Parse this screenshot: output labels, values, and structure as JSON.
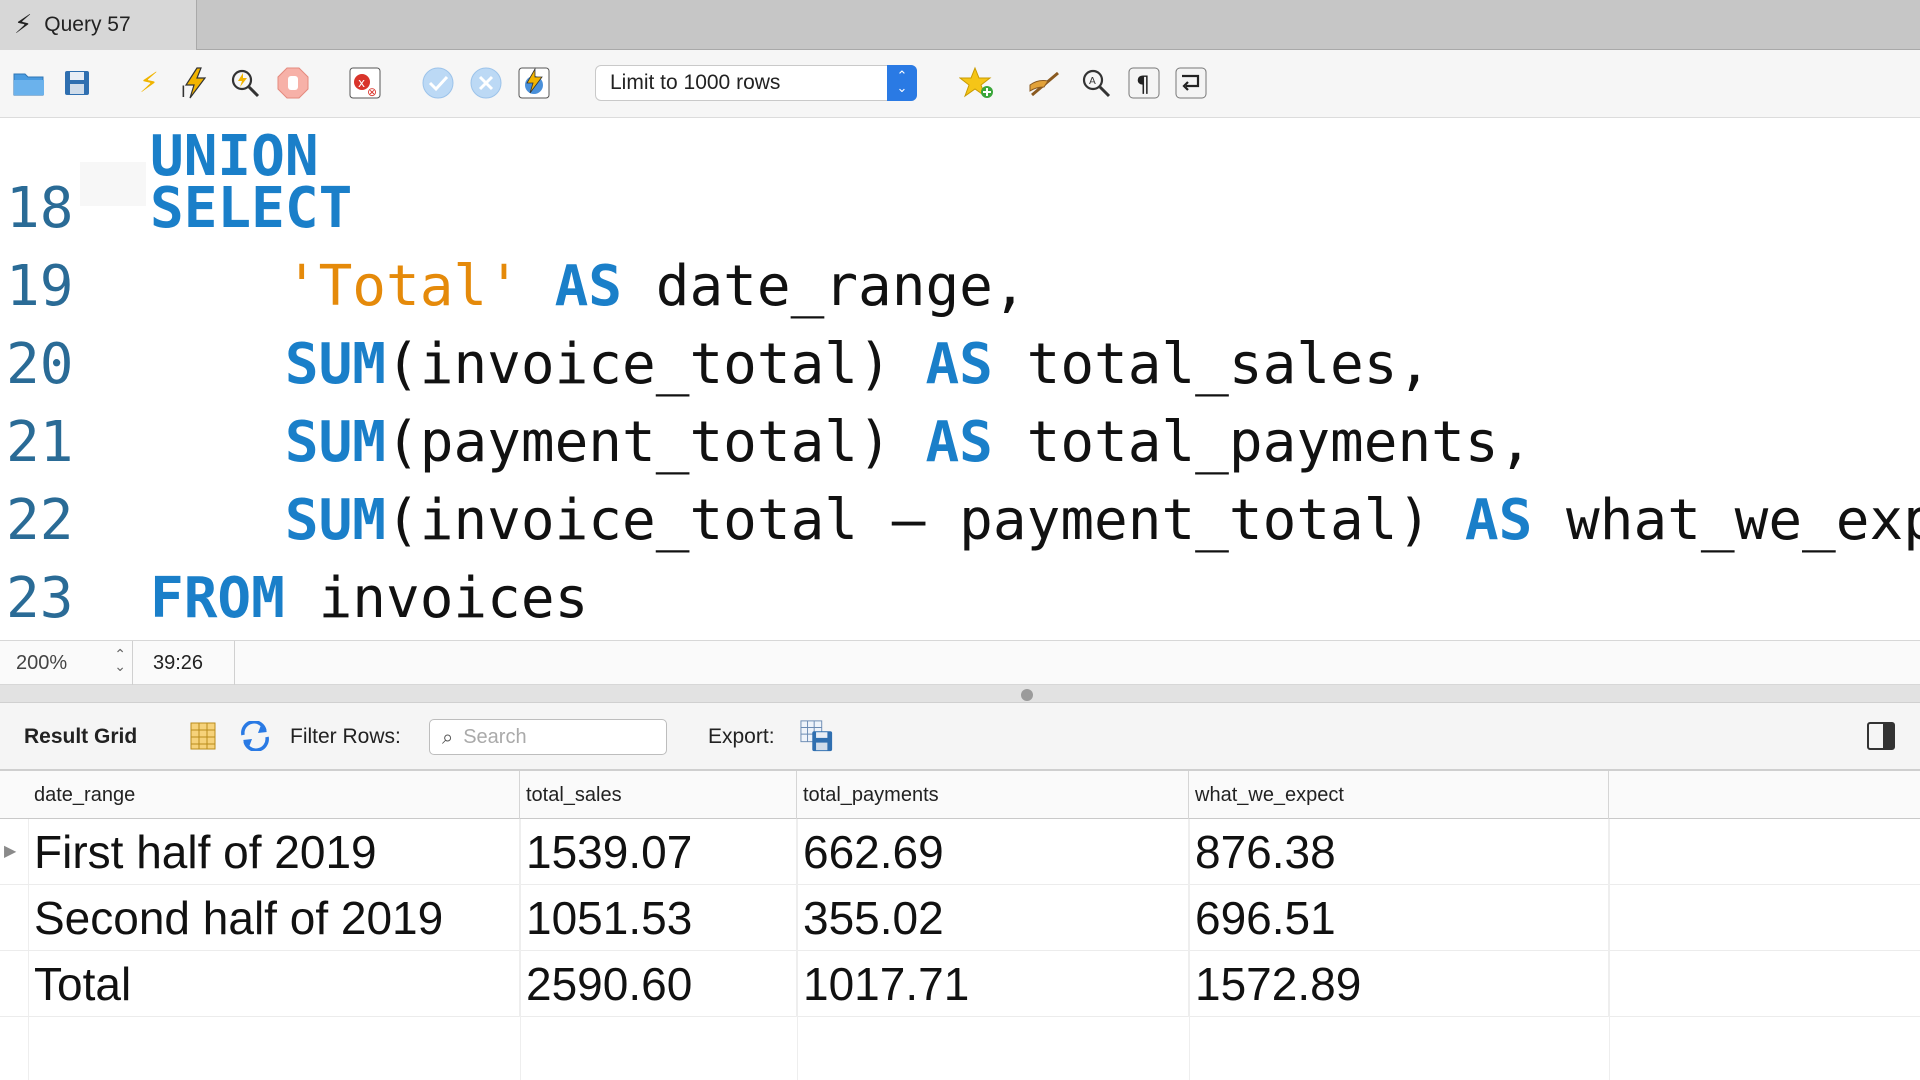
{
  "tab": {
    "title": "Query 57",
    "icon": "bolt-icon"
  },
  "toolbar": {
    "icons": [
      "open-folder-icon",
      "save-icon",
      "execute-icon",
      "execute-current-icon",
      "explain-icon",
      "stop-icon",
      "toggle-error-icon",
      "commit-icon",
      "rollback-icon",
      "autocommit-icon",
      "add-snippet-icon",
      "beautify-icon",
      "find-icon",
      "invisibles-icon",
      "wrap-icon"
    ],
    "limit_label": "Limit to 1000 rows"
  },
  "editor": {
    "lines": [
      {
        "num": "",
        "tokens": [
          {
            "t": "UNION",
            "c": "kw"
          }
        ]
      },
      {
        "num": "18",
        "tokens": [
          {
            "t": "SELECT",
            "c": "kw"
          }
        ]
      },
      {
        "num": "19",
        "tokens": [
          {
            "t": "    ",
            "c": "tx"
          },
          {
            "t": "'Total'",
            "c": "str"
          },
          {
            "t": " ",
            "c": "tx"
          },
          {
            "t": "AS",
            "c": "kw"
          },
          {
            "t": " date_range,",
            "c": "tx"
          }
        ]
      },
      {
        "num": "20",
        "tokens": [
          {
            "t": "    ",
            "c": "tx"
          },
          {
            "t": "SUM",
            "c": "kw"
          },
          {
            "t": "(invoice_total) ",
            "c": "tx"
          },
          {
            "t": "AS",
            "c": "kw"
          },
          {
            "t": " total_sales,",
            "c": "tx"
          }
        ]
      },
      {
        "num": "21",
        "tokens": [
          {
            "t": "    ",
            "c": "tx"
          },
          {
            "t": "SUM",
            "c": "kw"
          },
          {
            "t": "(payment_total) ",
            "c": "tx"
          },
          {
            "t": "AS",
            "c": "kw"
          },
          {
            "t": " total_payments,",
            "c": "tx"
          }
        ]
      },
      {
        "num": "22",
        "tokens": [
          {
            "t": "    ",
            "c": "tx"
          },
          {
            "t": "SUM",
            "c": "kw"
          },
          {
            "t": "(invoice_total – payment_total) ",
            "c": "tx"
          },
          {
            "t": "AS",
            "c": "kw"
          },
          {
            "t": " what_we_exp",
            "c": "tx"
          }
        ]
      },
      {
        "num": "23",
        "tokens": [
          {
            "t": "FROM",
            "c": "kw"
          },
          {
            "t": " invoices",
            "c": "tx"
          }
        ]
      }
    ]
  },
  "status": {
    "zoom": "200%",
    "cursor": "39:26"
  },
  "result_bar": {
    "title": "Result Grid",
    "filter_label": "Filter Rows:",
    "search_placeholder": "Search",
    "export_label": "Export:"
  },
  "grid": {
    "columns": [
      "date_range",
      "total_sales",
      "total_payments",
      "what_we_expect"
    ],
    "rows": [
      [
        "First half of 2019",
        "1539.07",
        "662.69",
        "876.38"
      ],
      [
        "Second half of 2019",
        "1051.53",
        "355.02",
        "696.51"
      ],
      [
        "Total",
        "2590.60",
        "1017.71",
        "1572.89"
      ]
    ]
  },
  "colors": {
    "keyword": "#1a7fc9",
    "string": "#e58a0a",
    "line_number": "#2a6b96",
    "accent": "#2a7ae4"
  }
}
